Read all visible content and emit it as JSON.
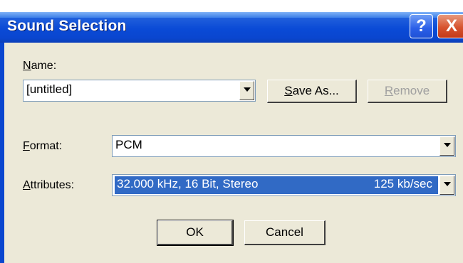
{
  "window": {
    "title": "Sound Selection"
  },
  "titlebar_buttons": {
    "help": "?",
    "close": "X"
  },
  "name": {
    "label": "Name:",
    "value": "[untitled]",
    "save_as_label": "Save As...",
    "remove_label": "Remove"
  },
  "format": {
    "label": "Format:",
    "value": "PCM"
  },
  "attributes": {
    "label": "Attributes:",
    "value": "32.000 kHz, 16 Bit, Stereo",
    "rate": "125 kb/sec"
  },
  "buttons": {
    "ok": "OK",
    "cancel": "Cancel"
  }
}
